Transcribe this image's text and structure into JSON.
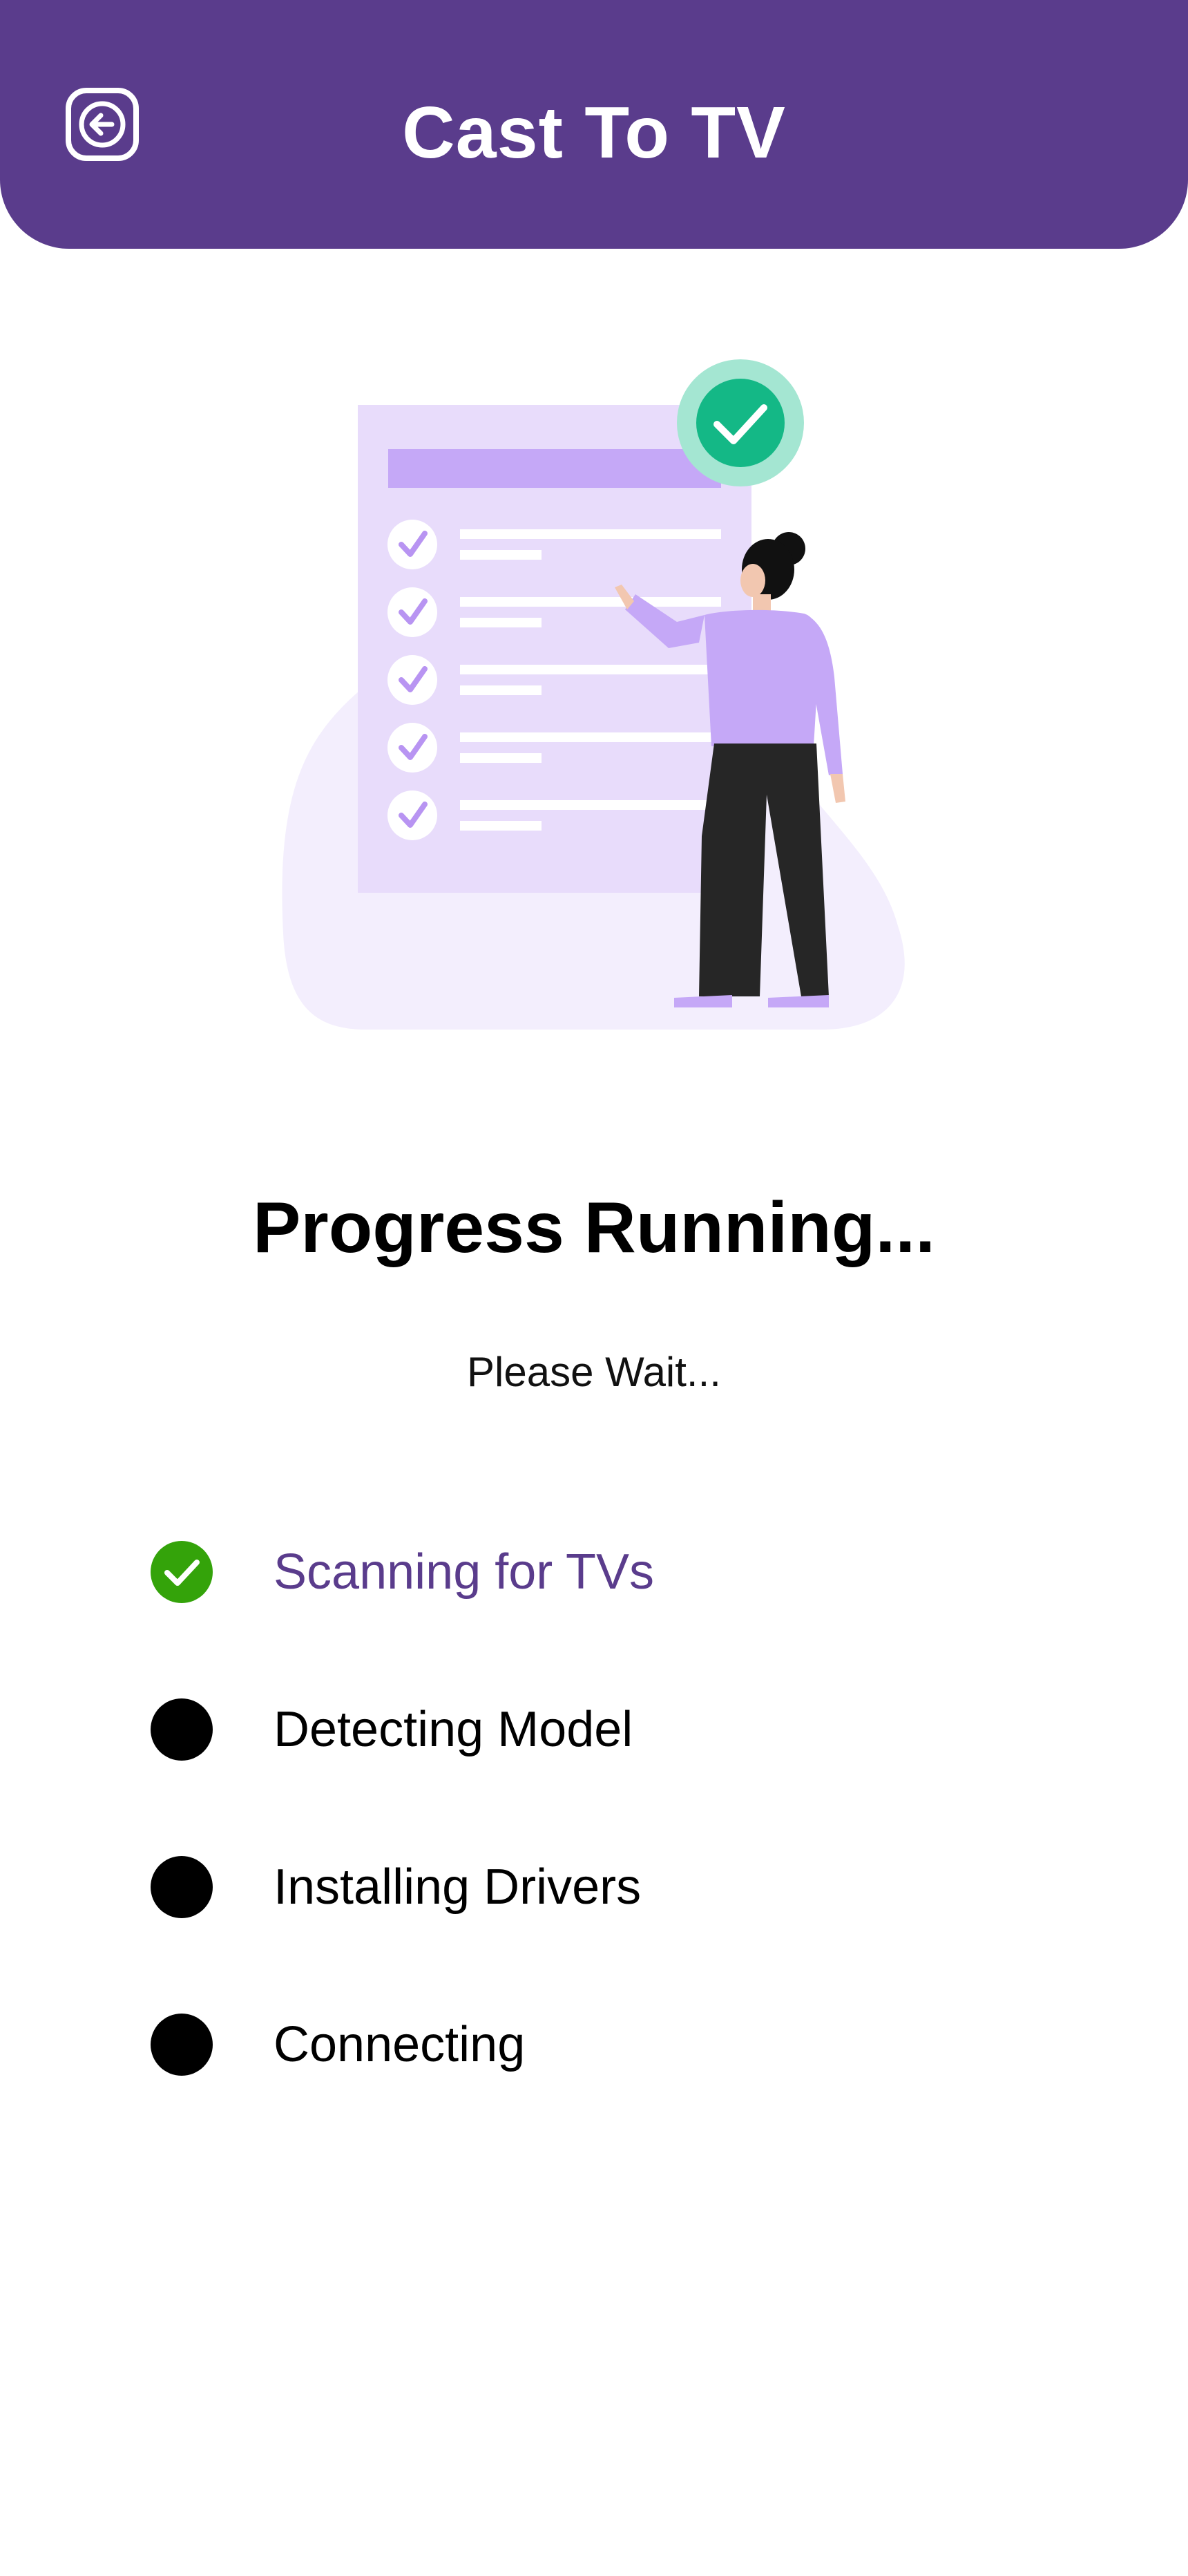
{
  "header": {
    "title": "Cast To TV",
    "back_icon": "back-arrow-icon",
    "background_color": "#5a3c8c"
  },
  "illustration": {
    "description_icon": "checklist-illustration"
  },
  "status": {
    "heading": "Progress Running...",
    "subheading": "Please Wait..."
  },
  "steps": [
    {
      "label": "Scanning for TVs",
      "state": "done",
      "icon": "check-circle-icon",
      "color": "#5a3c8c"
    },
    {
      "label": "Detecting Model",
      "state": "pending",
      "icon": "dot-icon",
      "color": "#000000"
    },
    {
      "label": "Installing Drivers",
      "state": "pending",
      "icon": "dot-icon",
      "color": "#000000"
    },
    {
      "label": "Connecting",
      "state": "pending",
      "icon": "dot-icon",
      "color": "#000000"
    }
  ],
  "colors": {
    "accent": "#5a3c8c",
    "success": "#34a30a"
  }
}
